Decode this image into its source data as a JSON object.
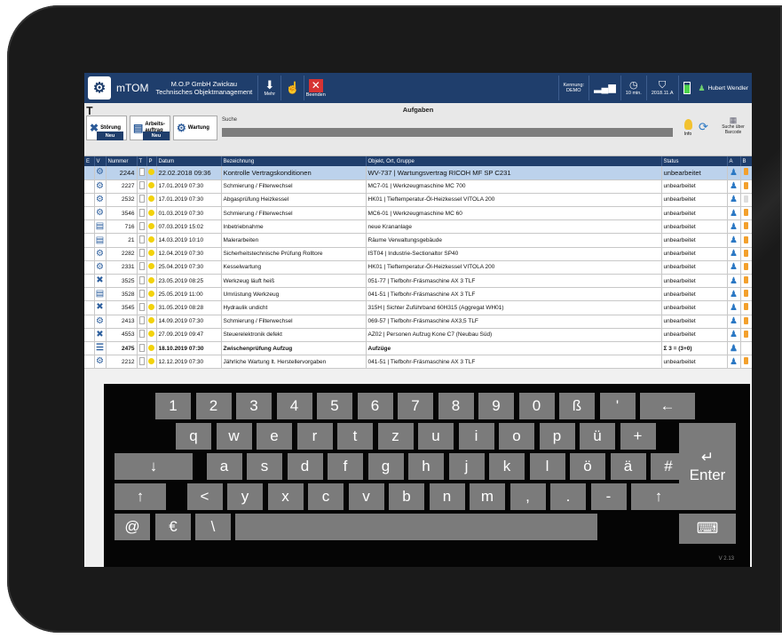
{
  "titlebar": {
    "app_name": "mTOM",
    "company_line1": "M.O.P GmbH Zwickau",
    "company_line2": "Technisches Objektmanagement",
    "btn_mehr": "Mehr",
    "btn_beenden": "Beenden",
    "kennung_label": "Kennung:",
    "kennung_value": "DEMO",
    "timer": "10 min.",
    "version_badge": "2018.11.A",
    "user_name": "Hubert Wendler"
  },
  "toolbar": {
    "page_title": "Aufgaben",
    "btn_stoerung": "Störung",
    "btn_arbeitsauftrag_1": "Arbeits-",
    "btn_arbeitsauftrag_2": "auftrag",
    "btn_wartung": "Wartung",
    "neu_label": "Neu",
    "search_label": "Suche",
    "info_label": "Info",
    "barcode_label_1": "Suche über",
    "barcode_label_2": "Barcode"
  },
  "table": {
    "headers": [
      "E",
      "V",
      "Nummer",
      "T",
      "P",
      "Datum",
      "Bezeichnung",
      "Objekt, Ort, Gruppe",
      "Status",
      "A",
      "B"
    ],
    "rows": [
      {
        "icon": "gear",
        "nummer": "2244",
        "datum": "22.02.2018 09:36",
        "bezeichnung": "Kontrolle Vertragskonditionen",
        "objekt": "WV-737 | Wartungsvertrag RICOH MF SP C231",
        "status": "unbearbeitet",
        "b": "flag"
      },
      {
        "icon": "gear",
        "nummer": "2227",
        "datum": "17.01.2019 07:30",
        "bezeichnung": "Schmierung / Filterwechsel",
        "objekt": "MC7-01 | Werkzeugmaschine MC 700",
        "status": "unbearbeitet",
        "b": "flag"
      },
      {
        "icon": "gear",
        "nummer": "2532",
        "datum": "17.01.2019 07:30",
        "bezeichnung": "Abgasprüfung Heizkessel",
        "objekt": "HK01 | Tieftemperatur-Öl-Heizkessel VITOLA 200",
        "status": "unbearbeitet",
        "b": "blank"
      },
      {
        "icon": "gear",
        "nummer": "3546",
        "datum": "01.03.2019 07:30",
        "bezeichnung": "Schmierung / Filterwechsel",
        "objekt": "MC6-01 | Werkzeugmaschine MC 60",
        "status": "unbearbeitet",
        "b": "flag"
      },
      {
        "icon": "doc",
        "nummer": "716",
        "datum": "07.03.2019 15:02",
        "bezeichnung": "Inbetriebnahme",
        "objekt": "neue Krananlage",
        "status": "unbearbeitet",
        "b": "flag"
      },
      {
        "icon": "doc",
        "nummer": "21",
        "datum": "14.03.2019 10:10",
        "bezeichnung": "Malerarbeiten",
        "objekt": "Räume Verwaltungsgebäude",
        "status": "unbearbeitet",
        "b": "flag"
      },
      {
        "icon": "gear",
        "nummer": "2282",
        "datum": "12.04.2019 07:30",
        "bezeichnung": "Sicherheitstechnische Prüfung Rolltore",
        "objekt": "IST04 | Industrie-Sectionaltor SP40",
        "status": "unbearbeitet",
        "b": "flag"
      },
      {
        "icon": "gear",
        "nummer": "2331",
        "datum": "25.04.2019 07:30",
        "bezeichnung": "Kesselwartung",
        "objekt": "HK01 | Tieftemperatur-Öl-Heizkessel VITOLA 200",
        "status": "unbearbeitet",
        "b": "flag"
      },
      {
        "icon": "tools",
        "nummer": "3525",
        "datum": "23.05.2019 08:25",
        "bezeichnung": "Werkzeug läuft heiß",
        "objekt": "051-77 | Tiefbohr-Fräsmaschine AX 3 TLF",
        "status": "unbearbeitet",
        "b": "flag"
      },
      {
        "icon": "doc",
        "nummer": "3528",
        "datum": "25.05.2019 11:00",
        "bezeichnung": "Umrüstung Werkzeug",
        "objekt": "041-51 | Tiefbohr-Fräsmaschine AX 3 TLF",
        "status": "unbearbeitet",
        "b": "flag"
      },
      {
        "icon": "tools",
        "nummer": "3545",
        "datum": "31.05.2019 08:28",
        "bezeichnung": "Hydraulik undicht",
        "objekt": "315H | Sichter Zuführband 60H315 (Aggregat WH01)",
        "status": "unbearbeitet",
        "b": "flag"
      },
      {
        "icon": "gear",
        "nummer": "2413",
        "datum": "14.09.2019 07:30",
        "bezeichnung": "Schmierung / Filterwechsel",
        "objekt": "069-57 | Tiefbohr-Fräsmaschine AX3,5 TLF",
        "status": "unbearbeitet",
        "b": "flag"
      },
      {
        "icon": "tools",
        "nummer": "4553",
        "datum": "27.09.2019 09:47",
        "bezeichnung": "Steuerelektronik defekt",
        "objekt": "AZ02 | Personen Aufzug Kone C7 (Neubau Süd)",
        "status": "unbearbeitet",
        "b": "flag"
      },
      {
        "icon": "list",
        "nummer": "2475",
        "datum": "18.10.2019 07:30",
        "bezeichnung": "Zwischenprüfung Aufzug",
        "objekt": "Aufzüge",
        "status": "Σ 3 = (3+0)",
        "b": "none"
      },
      {
        "icon": "gear",
        "nummer": "2212",
        "datum": "12.12.2019 07:30",
        "bezeichnung": "Jährliche Wartung lt. Herstellervorgaben",
        "objekt": "041-51 | Tiefbohr-Fräsmaschine AX 3 TLF",
        "status": "unbearbeitet",
        "b": "flag"
      }
    ]
  },
  "keyboard": {
    "row1": [
      "1",
      "2",
      "3",
      "4",
      "5",
      "6",
      "7",
      "8",
      "9",
      "0",
      "ß",
      "'",
      "←"
    ],
    "row2": [
      "q",
      "w",
      "e",
      "r",
      "t",
      "z",
      "u",
      "i",
      "o",
      "p",
      "ü",
      "+"
    ],
    "row3": [
      "↓",
      "a",
      "s",
      "d",
      "f",
      "g",
      "h",
      "j",
      "k",
      "l",
      "ö",
      "ä",
      "#"
    ],
    "row4": [
      "↑",
      "<",
      "y",
      "x",
      "c",
      "v",
      "b",
      "n",
      "m",
      ",",
      ".",
      "-",
      "↑"
    ],
    "row5": [
      "@",
      "€",
      "\\",
      " "
    ],
    "enter_label": "Enter",
    "enter_icon": "↵",
    "hide_icon": "⌨",
    "version": "V 2.13"
  }
}
